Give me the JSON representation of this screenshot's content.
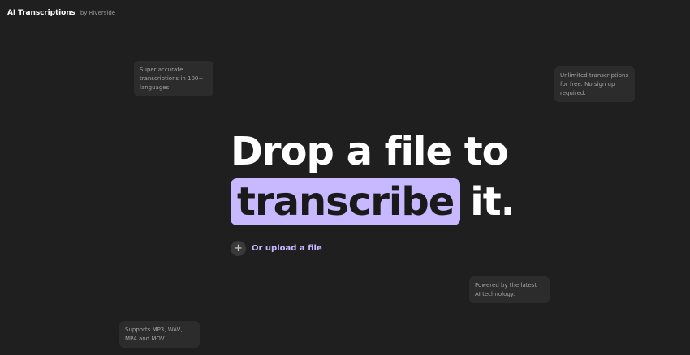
{
  "brand": {
    "title": "AI Transcriptions",
    "subtitle": "by Riverside"
  },
  "hero": {
    "line1": "Drop a file to",
    "highlight": "transcribe",
    "tail": "it.",
    "highlight_color": "#c8b8ff"
  },
  "upload": {
    "icon": "plus-icon",
    "icon_glyph": "+",
    "label": "Or upload a file"
  },
  "notes": [
    {
      "text": "Super accurate transcriptions in 100+ languages."
    },
    {
      "text": "Unlimited transcriptions for free. No sign up required."
    },
    {
      "text": "Powered by the latest AI technology."
    },
    {
      "text": "Supports MP3, WAV, MP4 and MOV."
    }
  ],
  "colors": {
    "background": "#1f1f1f",
    "card": "#2c2c2c",
    "accent": "#c8b8ff"
  }
}
